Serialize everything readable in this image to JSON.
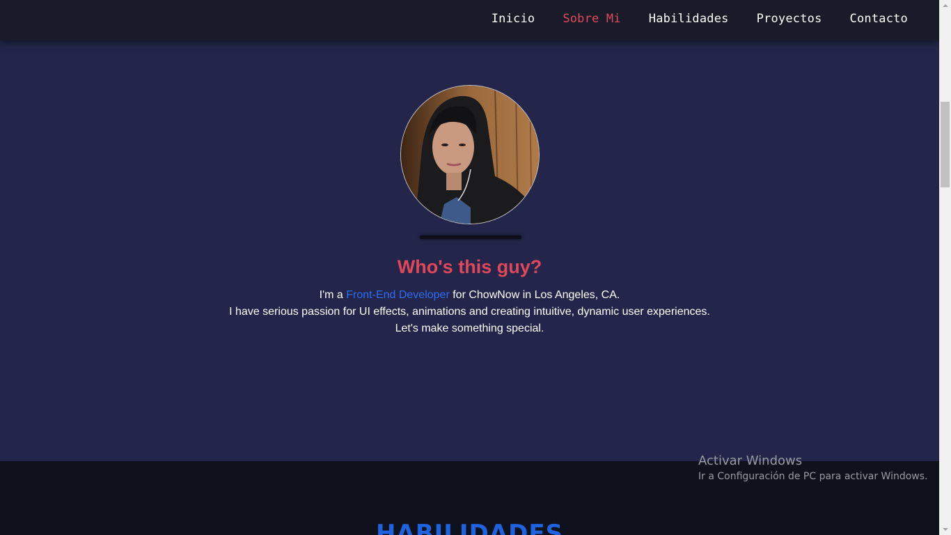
{
  "nav": {
    "items": [
      {
        "label": "Inicio",
        "active": false
      },
      {
        "label": "Sobre Mi",
        "active": true
      },
      {
        "label": "Habilidades",
        "active": false
      },
      {
        "label": "Proyectos",
        "active": false
      },
      {
        "label": "Contacto",
        "active": false
      }
    ]
  },
  "about": {
    "title": "Who's this guy?",
    "line1_prefix": "I'm a ",
    "line1_highlight": "Front-End Developer",
    "line1_suffix": " for ChowNow in Los Angeles, CA.",
    "line2": "I have serious passion for UI effects, animations and creating intuitive, dynamic user experiences.",
    "line3": "Let's make something special."
  },
  "skills": {
    "title": "HABILIDADES"
  },
  "watermark": {
    "title": "Activar Windows",
    "subtitle": "Ir a Configuración de PC para activar Windows."
  },
  "colors": {
    "accent_red": "#e0475a",
    "accent_blue": "#2e6df0",
    "nav_bg": "#1a1b28",
    "about_bg": "#23264a",
    "skills_bg": "#0f111d"
  }
}
